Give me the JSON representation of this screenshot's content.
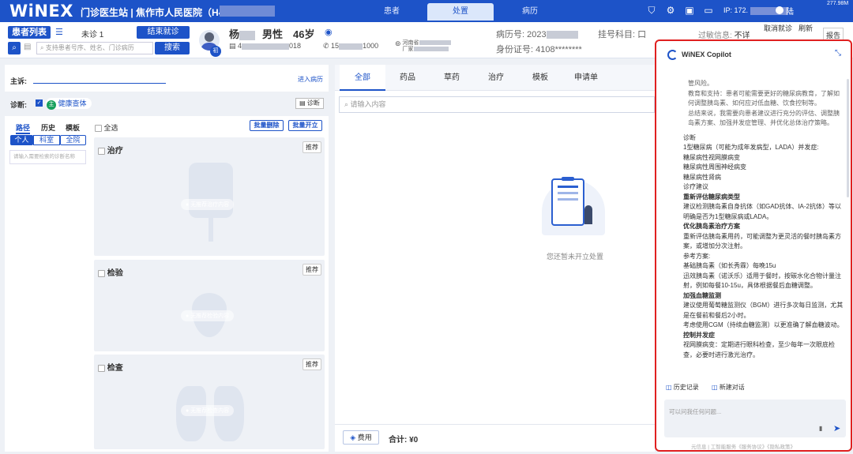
{
  "topbar": {
    "logo": "WiNEX",
    "title": "门诊医生站 | 焦作市人民医院（H41",
    "tabs": [
      "患者",
      "处置",
      "病历"
    ],
    "active_tab": "处置",
    "ip_label": "IP: 172.",
    "user_label": "陆",
    "speed": "277.98M"
  },
  "patient_bar": {
    "list_title": "患者列表",
    "visit_status": "未诊 1",
    "end_visit_button": "结束就诊",
    "search_placeholder": "支持患者号序、姓名、门诊病历",
    "search_button": "搜索",
    "avatar_badge": "初",
    "name": "杨",
    "gender": "男性",
    "age": "46岁",
    "id_fragment": "4",
    "id_tail": "018",
    "phone_prefix": "15",
    "phone_tail": "1000",
    "addr_line1": "河南省",
    "addr_line2": "厂家",
    "record_no_label": "病历号: 2023",
    "id_card_label": "身份证号: 4108********",
    "dept_label": "挂号科目: 口",
    "allergy_label": "过敏信息:",
    "allergy_value": "不详",
    "cancel_visit": "取消就诊",
    "refresh": "刷新",
    "report": "报告"
  },
  "left": {
    "complaint_label": "主诉:",
    "enter_record": "进入病历",
    "diagnosis_label": "诊断:",
    "diagnosis_badge": "主",
    "diagnosis_value": "健康查体",
    "diagnosis_button": "诊断",
    "path_tabs": [
      "路径",
      "历史",
      "模板"
    ],
    "scope_tabs": [
      "个人",
      "科室",
      "全院"
    ],
    "diag_search_placeholder": "请输入需要检索的诊断名称",
    "select_all": "全选",
    "batch_delete": "批量删除",
    "batch_open": "批量开立",
    "sections": [
      {
        "title": "治疗",
        "recommend": "推荐",
        "empty": "无推荐治疗内容"
      },
      {
        "title": "检验",
        "recommend": "推荐",
        "empty": "无推荐检验内容"
      },
      {
        "title": "检查",
        "recommend": "推荐",
        "empty": "无推荐检查内容"
      }
    ]
  },
  "middle": {
    "tabs": [
      "全部",
      "药品",
      "草药",
      "治疗",
      "模板",
      "申请单"
    ],
    "active_tab": "全部",
    "search_placeholder": "请输入内容",
    "empty_text": "您还暂未开立处置",
    "fee_button": "费用",
    "total_label": "合计: ¥0"
  },
  "copilot": {
    "title": "WiNEX Copilot",
    "lines": [
      {
        "t": "管风险。",
        "b": false,
        "indent": true
      },
      {
        "t": "教育和支持：患者可能需要更好的糖尿病教育，了解如何调整胰岛素、如何应对低血糖、饮食控制等。",
        "b": false,
        "indent": true
      },
      {
        "t": "总结来说，我需要向患者建议进行充分的评估、调整胰岛素方案、加强并发症管理、并优化总体治疗策略。",
        "b": false,
        "indent": true
      },
      {
        "t": "诊断",
        "b": false,
        "indent": false
      },
      {
        "t": "1型糖尿病（可能为成年发病型，LADA）并发症:",
        "b": false,
        "indent": false
      },
      {
        "t": "糖尿病性视网膜病变",
        "b": false,
        "indent": false
      },
      {
        "t": "糖尿病性周围神经病变",
        "b": false,
        "indent": false
      },
      {
        "t": "糖尿病性肾病",
        "b": false,
        "indent": false
      },
      {
        "t": "诊疗建议",
        "b": false,
        "indent": false
      },
      {
        "t": "重新评估糖尿病类型",
        "b": true,
        "indent": false
      },
      {
        "t": "建议检测胰岛素自身抗体（如GAD抗体、IA-2抗体）等以明确是否为1型糖尿病或LADA。",
        "b": false,
        "indent": false
      },
      {
        "t": "优化胰岛素治疗方案",
        "b": true,
        "indent": false
      },
      {
        "t": "重新评估胰岛素用药，可能调整为更灵活的餐时胰岛素方案，或增加分次注射。",
        "b": false,
        "indent": false
      },
      {
        "t": "参考方案:",
        "b": false,
        "indent": false
      },
      {
        "t": "基础胰岛素（如长秀霖）每晚15u",
        "b": false,
        "indent": false
      },
      {
        "t": "迅效胰岛素（诺沃乐）适用于餐时，按碳水化合物计量注射，例如每餐10-15u，具体根据餐后血糖调整。",
        "b": false,
        "indent": false
      },
      {
        "t": "加强血糖监测",
        "b": true,
        "indent": false
      },
      {
        "t": "建议使用葡萄糖监测仪（BGM）进行多次每日监测，尤其是在餐前和餐后2小时。",
        "b": false,
        "indent": false
      },
      {
        "t": "考虑使用CGM（持续血糖监测）以更准确了解血糖波动。",
        "b": false,
        "indent": false
      },
      {
        "t": "控制并发症",
        "b": true,
        "indent": false
      },
      {
        "t": "视网膜病变：定期进行眼科检查，至少每年一次眼底检查，必要时进行激光治疗。",
        "b": false,
        "indent": false
      }
    ],
    "history_button": "历史记录",
    "new_chat_button": "新建对话",
    "input_placeholder": "可以问我任何问题...",
    "footer": "元信息 | 工智能服务《服务协议》《隐私政策》"
  },
  "colors": {
    "brand": "#1d53c8",
    "highlight_border": "#e02020",
    "diagnosis_badge": "#17a05d"
  }
}
